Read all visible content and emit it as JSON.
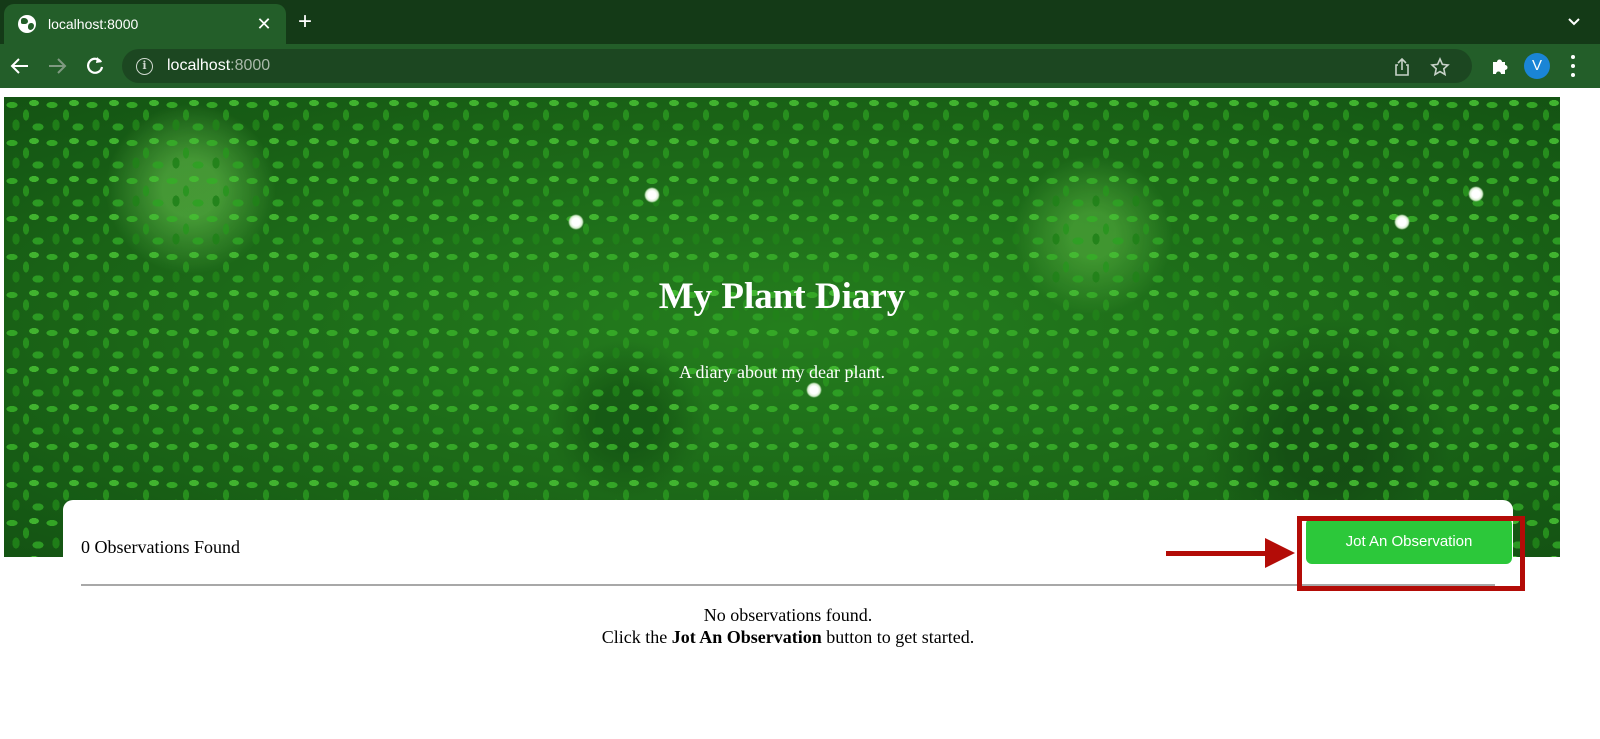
{
  "browser": {
    "tab_title": "localhost:8000",
    "new_tab_label": "+",
    "url_host": "localhost",
    "url_port": ":8000",
    "profile_initial": "V",
    "icons": {
      "tab": "globe-icon",
      "tab_close": "close-icon",
      "new_tab": "plus-icon",
      "tab_menu": "chevron-down-icon",
      "back": "back-arrow-icon",
      "forward": "forward-arrow-icon",
      "reload": "reload-icon",
      "site_info": "info-icon",
      "share": "share-icon",
      "bookmark": "star-icon",
      "extensions": "puzzle-icon",
      "menu": "kebab-menu-icon"
    }
  },
  "hero": {
    "title": "My Plant Diary",
    "subtitle": "A diary about my dear plant."
  },
  "observations": {
    "count_label": "0 Observations Found",
    "jot_button_label": "Jot An Observation",
    "empty_line1": "No observations found.",
    "empty_line2_prefix": "Click the ",
    "empty_line2_bold": "Jot An Observation",
    "empty_line2_suffix": " button to get started."
  },
  "colors": {
    "chrome_dark": "#143a17",
    "chrome_tab": "#235e29",
    "button_green": "#2cc83a",
    "annotation_red": "#b30c07",
    "avatar_blue": "#1a85d6"
  }
}
